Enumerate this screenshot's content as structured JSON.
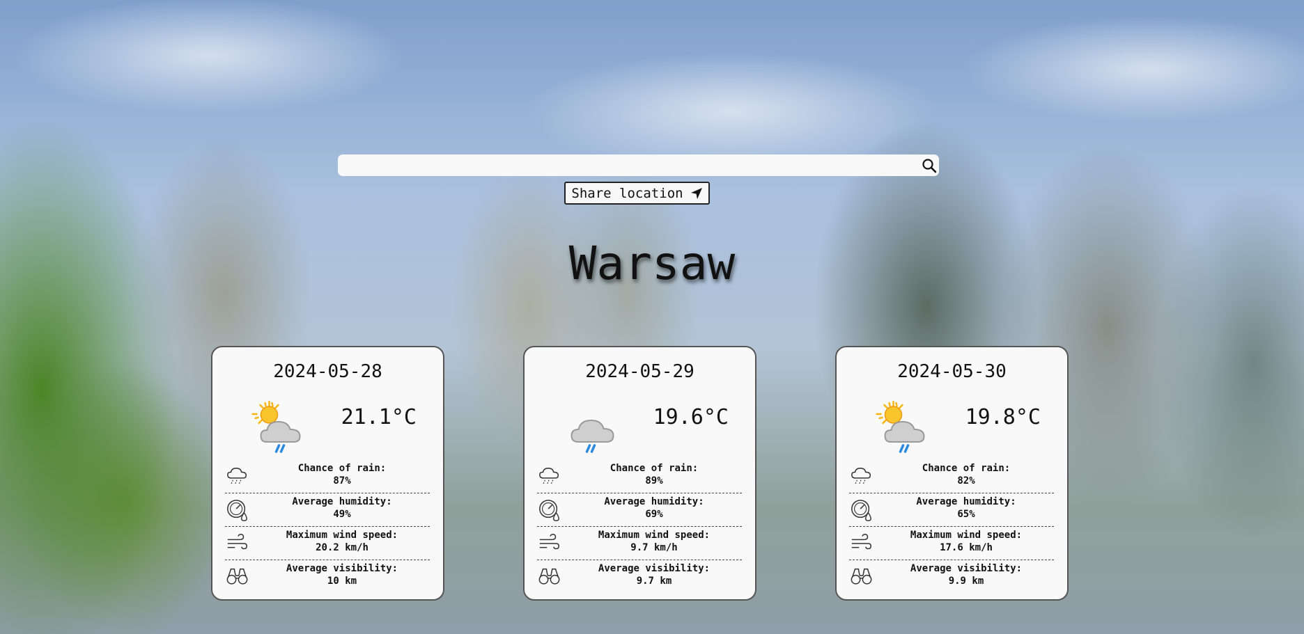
{
  "search": {
    "placeholder": "",
    "value": ""
  },
  "share_location": {
    "label": "Share location"
  },
  "city": "Warsaw",
  "stat_labels": {
    "rain": "Chance of rain:",
    "humidity": "Average humidity:",
    "wind": "Maximum wind speed:",
    "visibility": "Average visibility:"
  },
  "forecast": [
    {
      "date": "2024-05-28",
      "icon": "sun-cloud-rain-icon",
      "temperature": "21.1°C",
      "rain": "87%",
      "humidity": "49%",
      "wind": "20.2 km/h",
      "visibility": "10 km"
    },
    {
      "date": "2024-05-29",
      "icon": "cloud-rain-icon",
      "temperature": "19.6°C",
      "rain": "89%",
      "humidity": "69%",
      "wind": "9.7 km/h",
      "visibility": "9.7 km"
    },
    {
      "date": "2024-05-30",
      "icon": "sun-cloud-rain-icon",
      "temperature": "19.8°C",
      "rain": "82%",
      "humidity": "65%",
      "wind": "17.6 km/h",
      "visibility": "9.9 km"
    }
  ],
  "colors": {
    "card_bg": "#f9f9f9",
    "sun": "#f5b614",
    "rain": "#2b8ae0",
    "cloud": "#c8c8c8"
  }
}
